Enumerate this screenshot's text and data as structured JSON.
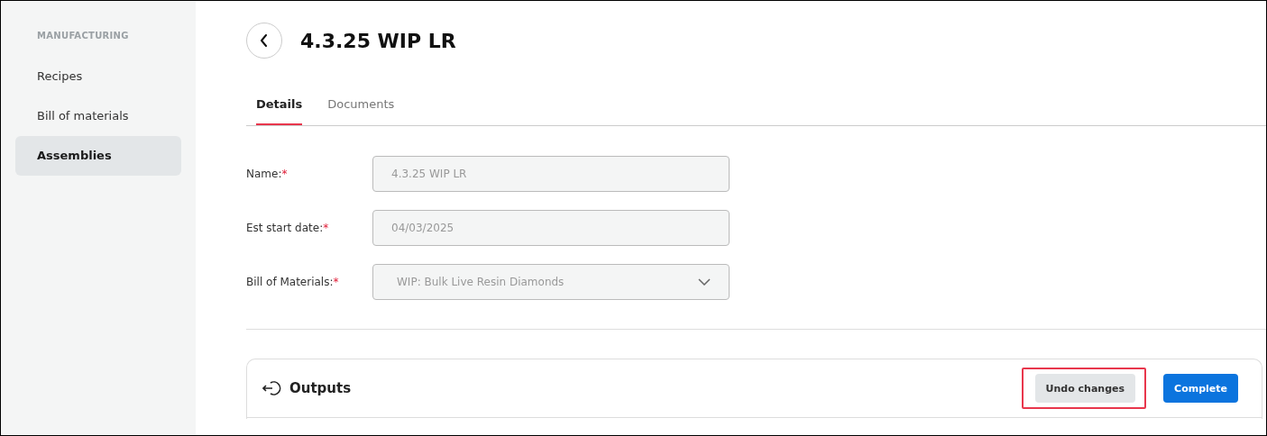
{
  "sidebar": {
    "section": "MANUFACTURING",
    "items": [
      {
        "label": "Recipes",
        "selected": false
      },
      {
        "label": "Bill of materials",
        "selected": false
      },
      {
        "label": "Assemblies",
        "selected": true
      }
    ]
  },
  "header": {
    "title": "4.3.25 WIP LR"
  },
  "tabs": [
    {
      "label": "Details",
      "selected": true
    },
    {
      "label": "Documents",
      "selected": false
    }
  ],
  "fields": [
    {
      "kind": "text",
      "label": "Name:",
      "required_mark": "*",
      "value": "4.3.25 WIP LR",
      "disabled": true
    },
    {
      "kind": "text",
      "label": "Est start date:",
      "required_mark": "*",
      "value": "04/03/2025",
      "disabled": true
    },
    {
      "kind": "select",
      "label": "Bill of Materials:",
      "required_mark": "*",
      "value": "WIP: Bulk Live Resin Diamonds",
      "disabled": true
    }
  ],
  "outputs": {
    "title": "Outputs",
    "buttons": [
      {
        "kind": "secondary",
        "label": "Undo changes",
        "highlighted": true
      },
      {
        "kind": "primary",
        "label": "Complete",
        "highlighted": false
      }
    ]
  }
}
